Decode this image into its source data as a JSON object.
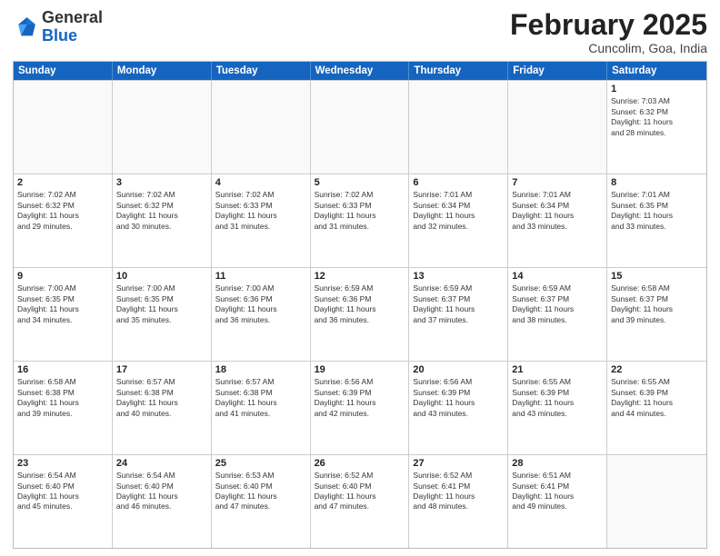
{
  "header": {
    "logo_general": "General",
    "logo_blue": "Blue",
    "month_title": "February 2025",
    "location": "Cuncolim, Goa, India"
  },
  "weekdays": [
    "Sunday",
    "Monday",
    "Tuesday",
    "Wednesday",
    "Thursday",
    "Friday",
    "Saturday"
  ],
  "rows": [
    [
      {
        "day": "",
        "info": ""
      },
      {
        "day": "",
        "info": ""
      },
      {
        "day": "",
        "info": ""
      },
      {
        "day": "",
        "info": ""
      },
      {
        "day": "",
        "info": ""
      },
      {
        "day": "",
        "info": ""
      },
      {
        "day": "1",
        "info": "Sunrise: 7:03 AM\nSunset: 6:32 PM\nDaylight: 11 hours\nand 28 minutes."
      }
    ],
    [
      {
        "day": "2",
        "info": "Sunrise: 7:02 AM\nSunset: 6:32 PM\nDaylight: 11 hours\nand 29 minutes."
      },
      {
        "day": "3",
        "info": "Sunrise: 7:02 AM\nSunset: 6:32 PM\nDaylight: 11 hours\nand 30 minutes."
      },
      {
        "day": "4",
        "info": "Sunrise: 7:02 AM\nSunset: 6:33 PM\nDaylight: 11 hours\nand 31 minutes."
      },
      {
        "day": "5",
        "info": "Sunrise: 7:02 AM\nSunset: 6:33 PM\nDaylight: 11 hours\nand 31 minutes."
      },
      {
        "day": "6",
        "info": "Sunrise: 7:01 AM\nSunset: 6:34 PM\nDaylight: 11 hours\nand 32 minutes."
      },
      {
        "day": "7",
        "info": "Sunrise: 7:01 AM\nSunset: 6:34 PM\nDaylight: 11 hours\nand 33 minutes."
      },
      {
        "day": "8",
        "info": "Sunrise: 7:01 AM\nSunset: 6:35 PM\nDaylight: 11 hours\nand 33 minutes."
      }
    ],
    [
      {
        "day": "9",
        "info": "Sunrise: 7:00 AM\nSunset: 6:35 PM\nDaylight: 11 hours\nand 34 minutes."
      },
      {
        "day": "10",
        "info": "Sunrise: 7:00 AM\nSunset: 6:35 PM\nDaylight: 11 hours\nand 35 minutes."
      },
      {
        "day": "11",
        "info": "Sunrise: 7:00 AM\nSunset: 6:36 PM\nDaylight: 11 hours\nand 36 minutes."
      },
      {
        "day": "12",
        "info": "Sunrise: 6:59 AM\nSunset: 6:36 PM\nDaylight: 11 hours\nand 36 minutes."
      },
      {
        "day": "13",
        "info": "Sunrise: 6:59 AM\nSunset: 6:37 PM\nDaylight: 11 hours\nand 37 minutes."
      },
      {
        "day": "14",
        "info": "Sunrise: 6:59 AM\nSunset: 6:37 PM\nDaylight: 11 hours\nand 38 minutes."
      },
      {
        "day": "15",
        "info": "Sunrise: 6:58 AM\nSunset: 6:37 PM\nDaylight: 11 hours\nand 39 minutes."
      }
    ],
    [
      {
        "day": "16",
        "info": "Sunrise: 6:58 AM\nSunset: 6:38 PM\nDaylight: 11 hours\nand 39 minutes."
      },
      {
        "day": "17",
        "info": "Sunrise: 6:57 AM\nSunset: 6:38 PM\nDaylight: 11 hours\nand 40 minutes."
      },
      {
        "day": "18",
        "info": "Sunrise: 6:57 AM\nSunset: 6:38 PM\nDaylight: 11 hours\nand 41 minutes."
      },
      {
        "day": "19",
        "info": "Sunrise: 6:56 AM\nSunset: 6:39 PM\nDaylight: 11 hours\nand 42 minutes."
      },
      {
        "day": "20",
        "info": "Sunrise: 6:56 AM\nSunset: 6:39 PM\nDaylight: 11 hours\nand 43 minutes."
      },
      {
        "day": "21",
        "info": "Sunrise: 6:55 AM\nSunset: 6:39 PM\nDaylight: 11 hours\nand 43 minutes."
      },
      {
        "day": "22",
        "info": "Sunrise: 6:55 AM\nSunset: 6:39 PM\nDaylight: 11 hours\nand 44 minutes."
      }
    ],
    [
      {
        "day": "23",
        "info": "Sunrise: 6:54 AM\nSunset: 6:40 PM\nDaylight: 11 hours\nand 45 minutes."
      },
      {
        "day": "24",
        "info": "Sunrise: 6:54 AM\nSunset: 6:40 PM\nDaylight: 11 hours\nand 46 minutes."
      },
      {
        "day": "25",
        "info": "Sunrise: 6:53 AM\nSunset: 6:40 PM\nDaylight: 11 hours\nand 47 minutes."
      },
      {
        "day": "26",
        "info": "Sunrise: 6:52 AM\nSunset: 6:40 PM\nDaylight: 11 hours\nand 47 minutes."
      },
      {
        "day": "27",
        "info": "Sunrise: 6:52 AM\nSunset: 6:41 PM\nDaylight: 11 hours\nand 48 minutes."
      },
      {
        "day": "28",
        "info": "Sunrise: 6:51 AM\nSunset: 6:41 PM\nDaylight: 11 hours\nand 49 minutes."
      },
      {
        "day": "",
        "info": ""
      }
    ]
  ]
}
